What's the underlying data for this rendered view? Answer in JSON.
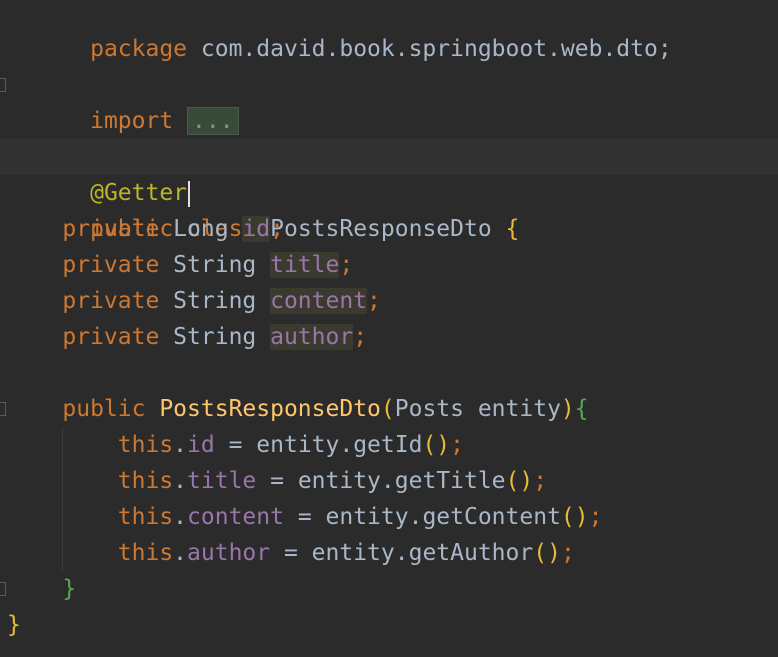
{
  "editor": {
    "lines": {
      "package_kw": "package",
      "package_name": " com.david.book.springboot.web.dto;",
      "import_kw": "import",
      "import_fold": "...",
      "annotation": "@Getter",
      "class_public": "public",
      "class_kw": " class",
      "class_name": " PostsResponseDto ",
      "class_brace": "{",
      "field_id_private": "private",
      "field_id_type": " Long ",
      "field_id_name": "id",
      "field_id_semi": ";",
      "field_title_private": "private",
      "field_title_type": " String ",
      "field_title_name": "title",
      "field_title_semi": ";",
      "field_content_private": "private",
      "field_content_type": " String ",
      "field_content_name": "content",
      "field_content_semi": ";",
      "field_author_private": "private",
      "field_author_type": " String ",
      "field_author_name": "author",
      "field_author_semi": ";",
      "ctor_public": "public",
      "ctor_name": " PostsResponseDto",
      "ctor_paren_open": "(",
      "ctor_params": "Posts entity",
      "ctor_paren_close": ")",
      "ctor_brace": "{",
      "assign_id_this": "this",
      "assign_id_dot": ".",
      "assign_id_field": "id",
      "assign_id_rest": " = entity.getId",
      "assign_id_parens": "()",
      "assign_id_semi": ";",
      "assign_title_this": "this",
      "assign_title_dot": ".",
      "assign_title_field": "title",
      "assign_title_rest": " = entity.getTitle",
      "assign_title_parens": "()",
      "assign_title_semi": ";",
      "assign_content_this": "this",
      "assign_content_dot": ".",
      "assign_content_field": "content",
      "assign_content_rest": " = entity.getContent",
      "assign_content_parens": "()",
      "assign_content_semi": ";",
      "assign_author_this": "this",
      "assign_author_dot": ".",
      "assign_author_field": "author",
      "assign_author_rest": " = entity.getAuthor",
      "assign_author_parens": "()",
      "assign_author_semi": ";",
      "ctor_close": "}",
      "class_close": "}"
    }
  },
  "colors": {
    "background": "#2b2b2b",
    "keyword": "#cc7832",
    "annotation": "#bbb529",
    "field": "#9876aa",
    "method": "#ffc66d",
    "text": "#a9b7c6"
  }
}
